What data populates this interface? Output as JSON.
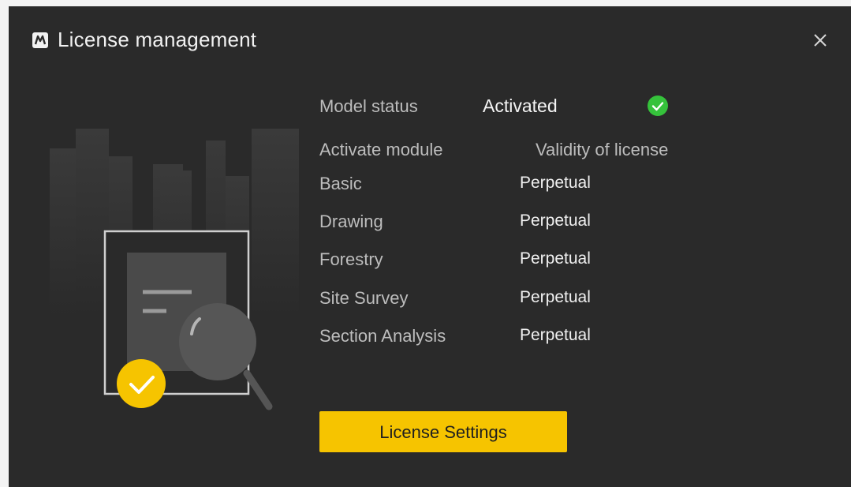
{
  "window": {
    "title": "License management",
    "app_icon": "app-logo-icon",
    "close_icon": "close-icon"
  },
  "status": {
    "label": "Model status",
    "value": "Activated",
    "icon": "check-circle-icon",
    "color": "#35c23b"
  },
  "modules_table": {
    "headers": [
      "Activate module",
      "Validity of license"
    ],
    "rows": [
      {
        "module": "Basic",
        "validity": "Perpetual"
      },
      {
        "module": "Drawing",
        "validity": "Perpetual"
      },
      {
        "module": "Forestry",
        "validity": "Perpetual"
      },
      {
        "module": "Site Survey",
        "validity": "Perpetual"
      },
      {
        "module": "Section Analysis",
        "validity": "Perpetual"
      }
    ]
  },
  "actions": {
    "license_settings_label": "License Settings"
  },
  "colors": {
    "dialog_bg": "#2a2a2a",
    "accent": "#f6c400",
    "status_ok": "#35c23b"
  }
}
